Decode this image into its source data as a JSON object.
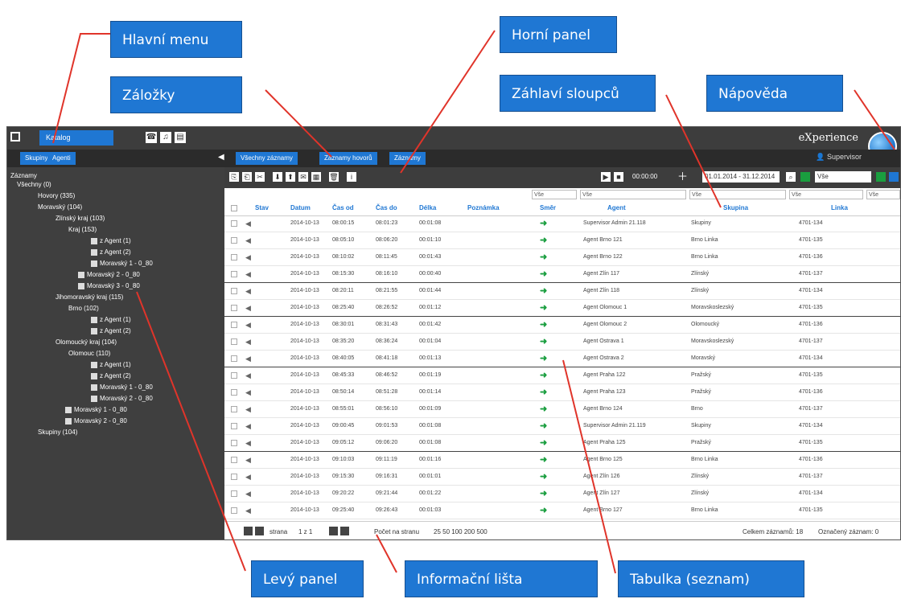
{
  "callouts": {
    "main_menu": "Hlavní menu",
    "tabs": "Záložky",
    "top_panel": "Horní panel",
    "column_headers": "Záhlaví sloupců",
    "help": "Nápověda",
    "left_panel": "Levý panel",
    "info_bar": "Informační lišta",
    "table": "Tabulka (seznam)"
  },
  "app": {
    "menu_label": "Katalog",
    "brand": "eXperience",
    "user": "Supervisor",
    "tabs": [
      "Všechny záznamy",
      "Záznamy hovorů",
      "Záznamy"
    ],
    "left_tabs": [
      "Skupiny",
      "Agenti"
    ],
    "toolbar": {
      "time": "00:00:00",
      "date_range": "01.01.2014 - 31.12.2014",
      "filter_value": "Vše"
    },
    "tree": [
      "Záznamy",
      "Všechny (0)",
      "Hovory (335)",
      "Moravský (104)",
      "Zlínský kraj (103)",
      "Kraj (153)",
      "z Agent (1)",
      "z Agent (2)",
      "Moravský 1 - 0_80",
      "Moravský 2 - 0_80",
      "Moravský 3 - 0_80",
      "Jihomoravský kraj (115)",
      "Brno (102)",
      "z Agent (1)",
      "z Agent (2)",
      "Olomoucký kraj (104)",
      "Olomouc (110)",
      "z Agent (1)",
      "z Agent (2)",
      "Moravský 1 - 0_80",
      "Moravský 2 - 0_80",
      "Moravský 1 - 0_80",
      "Moravský 2 - 0_80",
      "Skupiny (104)"
    ],
    "filters": [
      "Vše",
      "Vše",
      "Vše",
      "Vše",
      "Vše"
    ],
    "columns": [
      "Stav",
      "Datum",
      "Čas od",
      "Čas do",
      "Délka",
      "Poznámka",
      "Směr",
      "Agent",
      "Skupina",
      "Linka"
    ],
    "rows": [
      [
        "2014-10-13",
        "08:00:15",
        "08:01:23",
        "00:01:08",
        "Supervisor Admin 21.118",
        "Skupiny",
        "4701-134"
      ],
      [
        "2014-10-13",
        "08:05:10",
        "08:06:20",
        "00:01:10",
        "Agent Brno 121",
        "Brno Linka",
        "4701-135"
      ],
      [
        "2014-10-13",
        "08:10:02",
        "08:11:45",
        "00:01:43",
        "Agent Brno 122",
        "Brno Linka",
        "4701-136"
      ],
      [
        "2014-10-13",
        "08:15:30",
        "08:16:10",
        "00:00:40",
        "Agent Zlín 117",
        "Zlínský",
        "4701-137"
      ],
      [
        "2014-10-13",
        "08:20:11",
        "08:21:55",
        "00:01:44",
        "Agent Zlín 118",
        "Zlínský",
        "4701-134"
      ],
      [
        "2014-10-13",
        "08:25:40",
        "08:26:52",
        "00:01:12",
        "Agent Olomouc 1",
        "Moravskoslezský",
        "4701-135"
      ],
      [
        "2014-10-13",
        "08:30:01",
        "08:31:43",
        "00:01:42",
        "Agent Olomouc 2",
        "Olomoucký",
        "4701-136"
      ],
      [
        "2014-10-13",
        "08:35:20",
        "08:36:24",
        "00:01:04",
        "Agent Ostrava 1",
        "Moravskoslezský",
        "4701-137"
      ],
      [
        "2014-10-13",
        "08:40:05",
        "08:41:18",
        "00:01:13",
        "Agent Ostrava 2",
        "Moravský",
        "4701-134"
      ],
      [
        "2014-10-13",
        "08:45:33",
        "08:46:52",
        "00:01:19",
        "Agent Praha 122",
        "Pražský",
        "4701-135"
      ],
      [
        "2014-10-13",
        "08:50:14",
        "08:51:28",
        "00:01:14",
        "Agent Praha 123",
        "Pražský",
        "4701-136"
      ],
      [
        "2014-10-13",
        "08:55:01",
        "08:56:10",
        "00:01:09",
        "Agent Brno 124",
        "Brno",
        "4701-137"
      ],
      [
        "2014-10-13",
        "09:00:45",
        "09:01:53",
        "00:01:08",
        "Supervisor Admin 21.119",
        "Skupiny",
        "4701-134"
      ],
      [
        "2014-10-13",
        "09:05:12",
        "09:06:20",
        "00:01:08",
        "Agent Praha 125",
        "Pražský",
        "4701-135"
      ],
      [
        "2014-10-13",
        "09:10:03",
        "09:11:19",
        "00:01:16",
        "Agent Brno 125",
        "Brno Linka",
        "4701-136"
      ],
      [
        "2014-10-13",
        "09:15:30",
        "09:16:31",
        "00:01:01",
        "Agent Zlín 126",
        "Zlínský",
        "4701-137"
      ],
      [
        "2014-10-13",
        "09:20:22",
        "09:21:44",
        "00:01:22",
        "Agent Zlín 127",
        "Zlínský",
        "4701-134"
      ],
      [
        "2014-10-13",
        "09:25:40",
        "09:26:43",
        "00:01:03",
        "Agent Brno 127",
        "Brno Linka",
        "4701-135"
      ]
    ],
    "info": {
      "page_label": "strana",
      "page_of": "1 z 1",
      "per_page_label": "Počet na stranu",
      "per_page_options": "25 50 100 200 500",
      "total": "Celkem záznamů: 18",
      "selected": "Označený záznam: 0"
    }
  }
}
